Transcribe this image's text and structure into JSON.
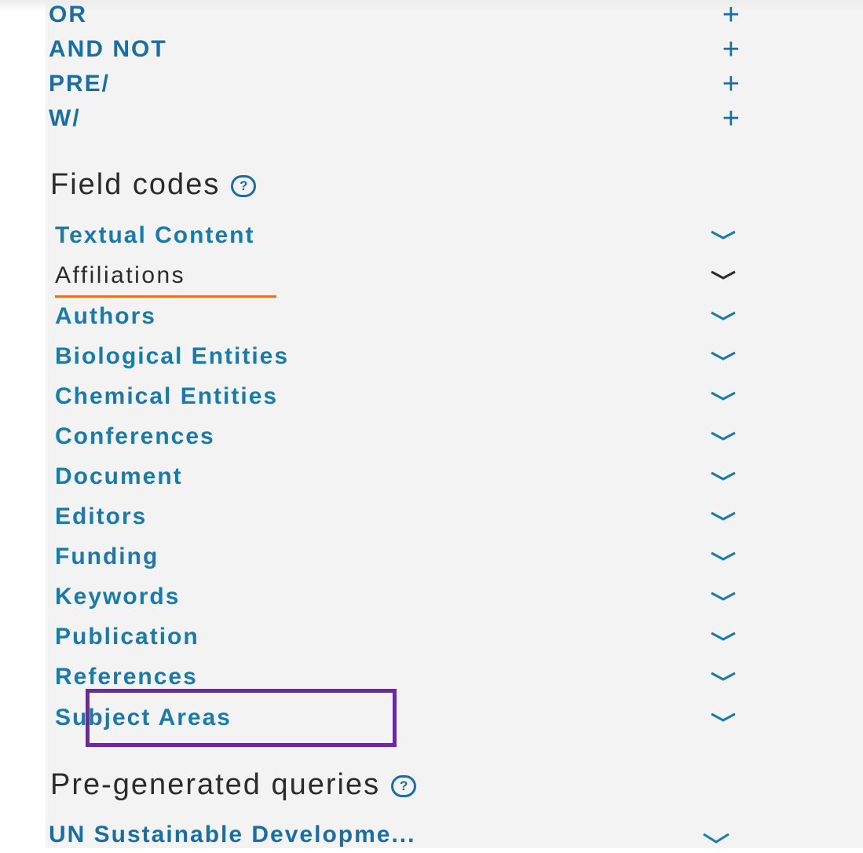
{
  "operators": [
    {
      "label": "OR",
      "icon": "plus-icon",
      "symbol": "+"
    },
    {
      "label": "AND NOT",
      "icon": "plus-icon",
      "symbol": "+"
    },
    {
      "label": "PRE/",
      "icon": "plus-icon",
      "symbol": "+"
    },
    {
      "label": "W/",
      "icon": "plus-icon",
      "symbol": "+"
    }
  ],
  "field_codes": {
    "title": "Field codes",
    "help_symbol": "?",
    "items": [
      {
        "label": "Textual Content"
      },
      {
        "label": "Affiliations"
      },
      {
        "label": "Authors"
      },
      {
        "label": "Biological Entities"
      },
      {
        "label": "Chemical Entities"
      },
      {
        "label": "Conferences"
      },
      {
        "label": "Document"
      },
      {
        "label": "Editors"
      },
      {
        "label": "Funding"
      },
      {
        "label": "Keywords"
      },
      {
        "label": "Publication"
      },
      {
        "label": "References"
      },
      {
        "label": "Subject Areas"
      }
    ],
    "active_item": "Affiliations",
    "highlighted_item": "Subject Areas"
  },
  "pregenerated": {
    "title": "Pre-generated queries",
    "help_symbol": "?",
    "items": [
      {
        "label": "UN Sustainable Developme..."
      }
    ]
  },
  "colors": {
    "link": "#1a7aa8",
    "active_text": "#2b2b2b",
    "active_underline": "#e9711c",
    "highlight_border": "#6b2aa1",
    "panel_bg": "#f3f3f3"
  }
}
